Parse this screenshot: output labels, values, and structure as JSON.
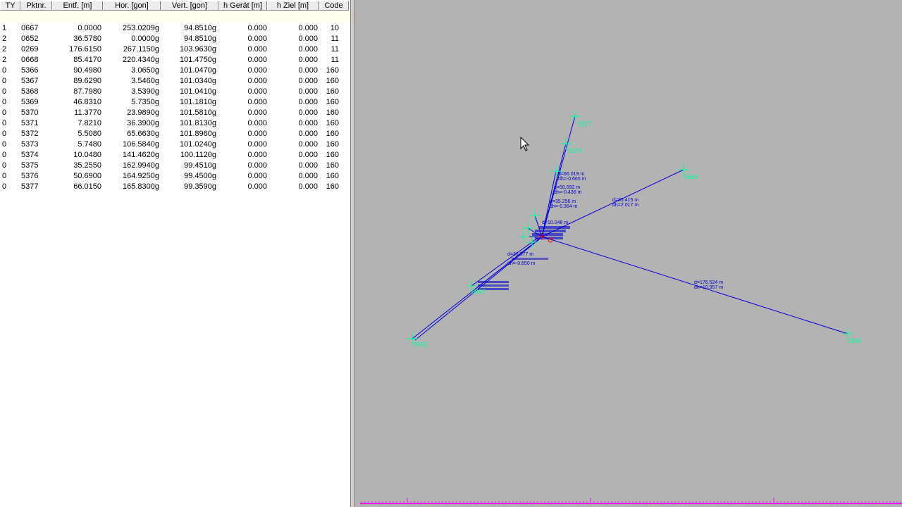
{
  "table": {
    "columns": [
      "TY",
      "Pktnr.",
      "Entf. [m]",
      "Hor. [gon]",
      "Vert. [gon]",
      "h Gerät [m]",
      "h Ziel [m]",
      "Code"
    ],
    "rows": [
      {
        "ty": "1",
        "pktnr": "0667",
        "entf": "0.0000",
        "hor": "253.0209g",
        "vert": "94.8510g",
        "hgeraet": "0.000",
        "hziel": "0.000",
        "code": "10"
      },
      {
        "ty": "2",
        "pktnr": "0652",
        "entf": "36.5780",
        "hor": "0.0000g",
        "vert": "94.8510g",
        "hgeraet": "0.000",
        "hziel": "0.000",
        "code": "11"
      },
      {
        "ty": "2",
        "pktnr": "0269",
        "entf": "176.6150",
        "hor": "267.1150g",
        "vert": "103.9630g",
        "hgeraet": "0.000",
        "hziel": "0.000",
        "code": "11"
      },
      {
        "ty": "2",
        "pktnr": "0668",
        "entf": "85.4170",
        "hor": "220.4340g",
        "vert": "101.4750g",
        "hgeraet": "0.000",
        "hziel": "0.000",
        "code": "11"
      },
      {
        "ty": "0",
        "pktnr": "5366",
        "entf": "90.4980",
        "hor": "3.0650g",
        "vert": "101.0470g",
        "hgeraet": "0.000",
        "hziel": "0.000",
        "code": "160"
      },
      {
        "ty": "0",
        "pktnr": "5367",
        "entf": "89.6290",
        "hor": "3.5460g",
        "vert": "101.0340g",
        "hgeraet": "0.000",
        "hziel": "0.000",
        "code": "160"
      },
      {
        "ty": "0",
        "pktnr": "5368",
        "entf": "87.7980",
        "hor": "3.5390g",
        "vert": "101.0410g",
        "hgeraet": "0.000",
        "hziel": "0.000",
        "code": "160"
      },
      {
        "ty": "0",
        "pktnr": "5369",
        "entf": "46.8310",
        "hor": "5.7350g",
        "vert": "101.1810g",
        "hgeraet": "0.000",
        "hziel": "0.000",
        "code": "160"
      },
      {
        "ty": "0",
        "pktnr": "5370",
        "entf": "11.3770",
        "hor": "23.9890g",
        "vert": "101.5810g",
        "hgeraet": "0.000",
        "hziel": "0.000",
        "code": "160"
      },
      {
        "ty": "0",
        "pktnr": "5371",
        "entf": "7.8210",
        "hor": "36.3900g",
        "vert": "101.8130g",
        "hgeraet": "0.000",
        "hziel": "0.000",
        "code": "160"
      },
      {
        "ty": "0",
        "pktnr": "5372",
        "entf": "5.5080",
        "hor": "65.6630g",
        "vert": "101.8960g",
        "hgeraet": "0.000",
        "hziel": "0.000",
        "code": "160"
      },
      {
        "ty": "0",
        "pktnr": "5373",
        "entf": "5.7480",
        "hor": "106.5840g",
        "vert": "101.0240g",
        "hgeraet": "0.000",
        "hziel": "0.000",
        "code": "160"
      },
      {
        "ty": "0",
        "pktnr": "5374",
        "entf": "10.0480",
        "hor": "141.4620g",
        "vert": "100.1120g",
        "hgeraet": "0.000",
        "hziel": "0.000",
        "code": "160"
      },
      {
        "ty": "0",
        "pktnr": "5375",
        "entf": "35.2550",
        "hor": "162.9940g",
        "vert": "99.4510g",
        "hgeraet": "0.000",
        "hziel": "0.000",
        "code": "160"
      },
      {
        "ty": "0",
        "pktnr": "5376",
        "entf": "50.6900",
        "hor": "164.9250g",
        "vert": "99.4500g",
        "hgeraet": "0.000",
        "hziel": "0.000",
        "code": "160"
      },
      {
        "ty": "0",
        "pktnr": "5377",
        "entf": "66.0150",
        "hor": "165.8300g",
        "vert": "99.3590g",
        "hgeraet": "0.000",
        "hziel": "0.000",
        "code": "160"
      }
    ]
  },
  "plot": {
    "colors": {
      "background": "#b3b3b3",
      "lines": "#0000dd",
      "points": "#00ff99",
      "station": "#ff0000",
      "ruler": "#ff00ff"
    },
    "point_labels": [
      "5377",
      "5376",
      "0668",
      "0269",
      "0652",
      "0667"
    ],
    "measurement_labels": [
      "d=66.019 m",
      "dh=-0.665 m",
      "d=50.692 m",
      "dh=-0.436 m",
      "d=35.256 m",
      "dh=-0.364 m",
      "d=10.048 m",
      "d=85.415 m",
      "dh=2.017 m",
      "d=176.524 m",
      "dh=10.957 m",
      "d=36.577 m",
      "dh=-0.650 m"
    ],
    "icons": {
      "cursor": "mouse-pointer-icon",
      "point_marker": "crosshair-icon"
    }
  }
}
